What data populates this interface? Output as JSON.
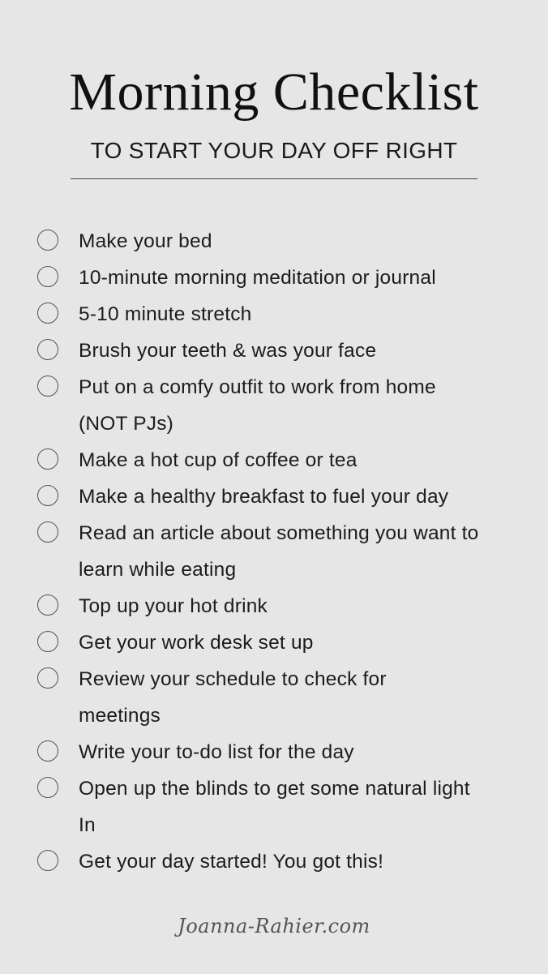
{
  "header": {
    "title": "Morning Checklist",
    "subtitle": "TO START YOUR DAY OFF RIGHT"
  },
  "checklist": {
    "items": [
      {
        "label": "Make your bed",
        "checked": false
      },
      {
        "label": "10-minute morning meditation or journal",
        "checked": false
      },
      {
        "label": "5-10 minute stretch",
        "checked": false
      },
      {
        "label": "Brush your teeth & was your face",
        "checked": false
      },
      {
        "label": "Put on a comfy outfit to work from home (NOT PJs)",
        "checked": false
      },
      {
        "label": "Make a hot cup of coffee or tea",
        "checked": false
      },
      {
        "label": "Make a healthy breakfast to fuel your day",
        "checked": false
      },
      {
        "label": "Read an article about something you want to learn while eating",
        "checked": false
      },
      {
        "label": "Top up your hot drink",
        "checked": false
      },
      {
        "label": "Get your work desk set up",
        "checked": false
      },
      {
        "label": "Review your schedule to check for meetings",
        "checked": false
      },
      {
        "label": "Write your to-do list for the day",
        "checked": false
      },
      {
        "label": "Open up the blinds to get some natural light In",
        "checked": false
      },
      {
        "label": "Get your day started! You got this!",
        "checked": false
      }
    ]
  },
  "footer": {
    "signature": "Joanna-Rahier.com"
  },
  "colors": {
    "background": "#e6e6e6",
    "text": "#1a1a1a",
    "circle_stroke": "#555555"
  }
}
